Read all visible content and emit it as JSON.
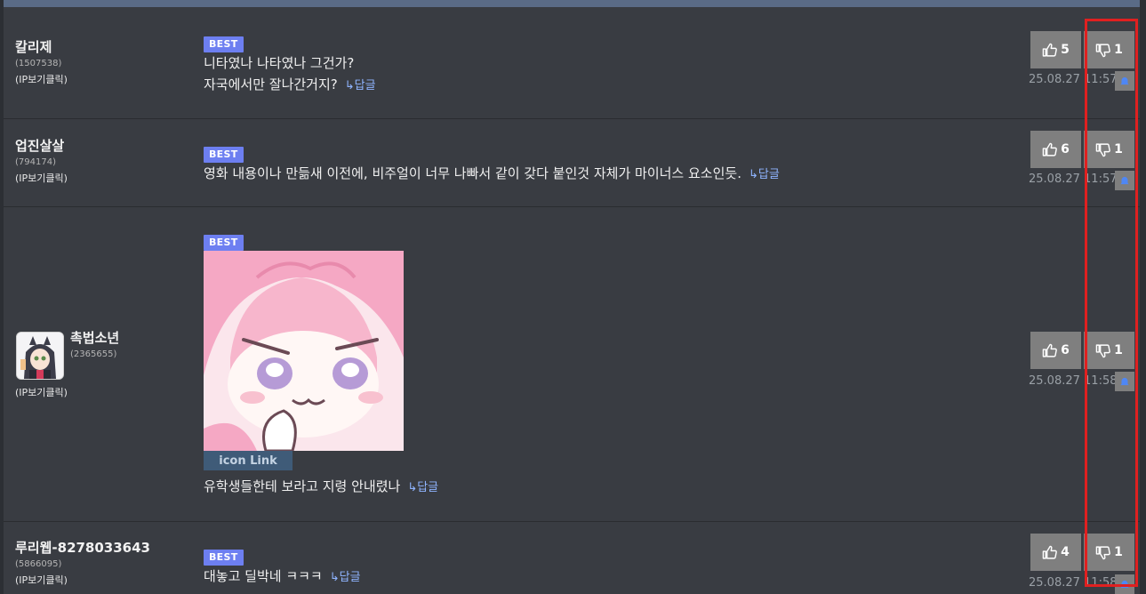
{
  "comments": [
    {
      "nick": "칼리제",
      "uid": "(1507538)",
      "ip": "(IP보기클릭)",
      "badge": "BEST",
      "lines": [
        "니타였나 나타였나 그건가?",
        "자국에서만 잘나간거지?"
      ],
      "reply": "↳답글",
      "up": "5",
      "down": "1",
      "date": "25.08.27 11:57"
    },
    {
      "nick": "업진살살",
      "uid": "(794174)",
      "ip": "(IP보기클릭)",
      "badge": "BEST",
      "lines": [
        "영화 내용이나 만듦새 이전에, 비주얼이 너무 나빠서 같이 갖다 붙인것 자체가 마이너스 요소인듯."
      ],
      "reply": "↳답글",
      "up": "6",
      "down": "1",
      "date": "25.08.27 11:57"
    },
    {
      "nick": "촉법소년",
      "uid": "(2365655)",
      "ip": "(IP보기클릭)",
      "badge": "BEST",
      "icon_link": "icon Link",
      "lines": [
        "유학생들한테 보라고 지령 안내렸나"
      ],
      "reply": "↳답글",
      "up": "6",
      "down": "1",
      "date": "25.08.27 11:58"
    },
    {
      "nick": "루리웹-8278033643",
      "uid": "(5866095)",
      "ip": "(IP보기클릭)",
      "badge": "BEST",
      "lines": [
        "대놓고 딜박네 ㅋㅋㅋ"
      ],
      "reply": "↳답글",
      "up": "4",
      "down": "1",
      "date": "25.08.27 11:58"
    }
  ],
  "colors": {
    "best_badge": "#6d7ff1",
    "reply_link": "#8fb4ff",
    "highlight": "#e02020"
  }
}
